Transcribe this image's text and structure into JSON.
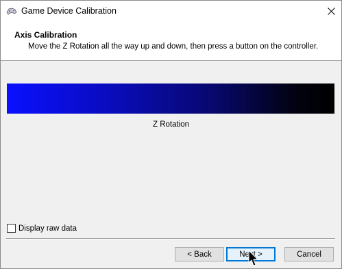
{
  "window": {
    "title": "Game Device Calibration",
    "icons": {
      "app": "gamepad-icon",
      "close": "close-icon"
    }
  },
  "header": {
    "title": "Axis Calibration",
    "subtitle": "Move the Z Rotation all the way up and down, then press a button on the controller."
  },
  "axis": {
    "label": "Z Rotation",
    "colors": {
      "start": "#0a10ff",
      "end": "#000000"
    }
  },
  "options": {
    "display_raw_data": {
      "label": "Display raw data",
      "checked": false
    }
  },
  "buttons": {
    "back": "< Back",
    "next": "Next >",
    "cancel": "Cancel"
  }
}
